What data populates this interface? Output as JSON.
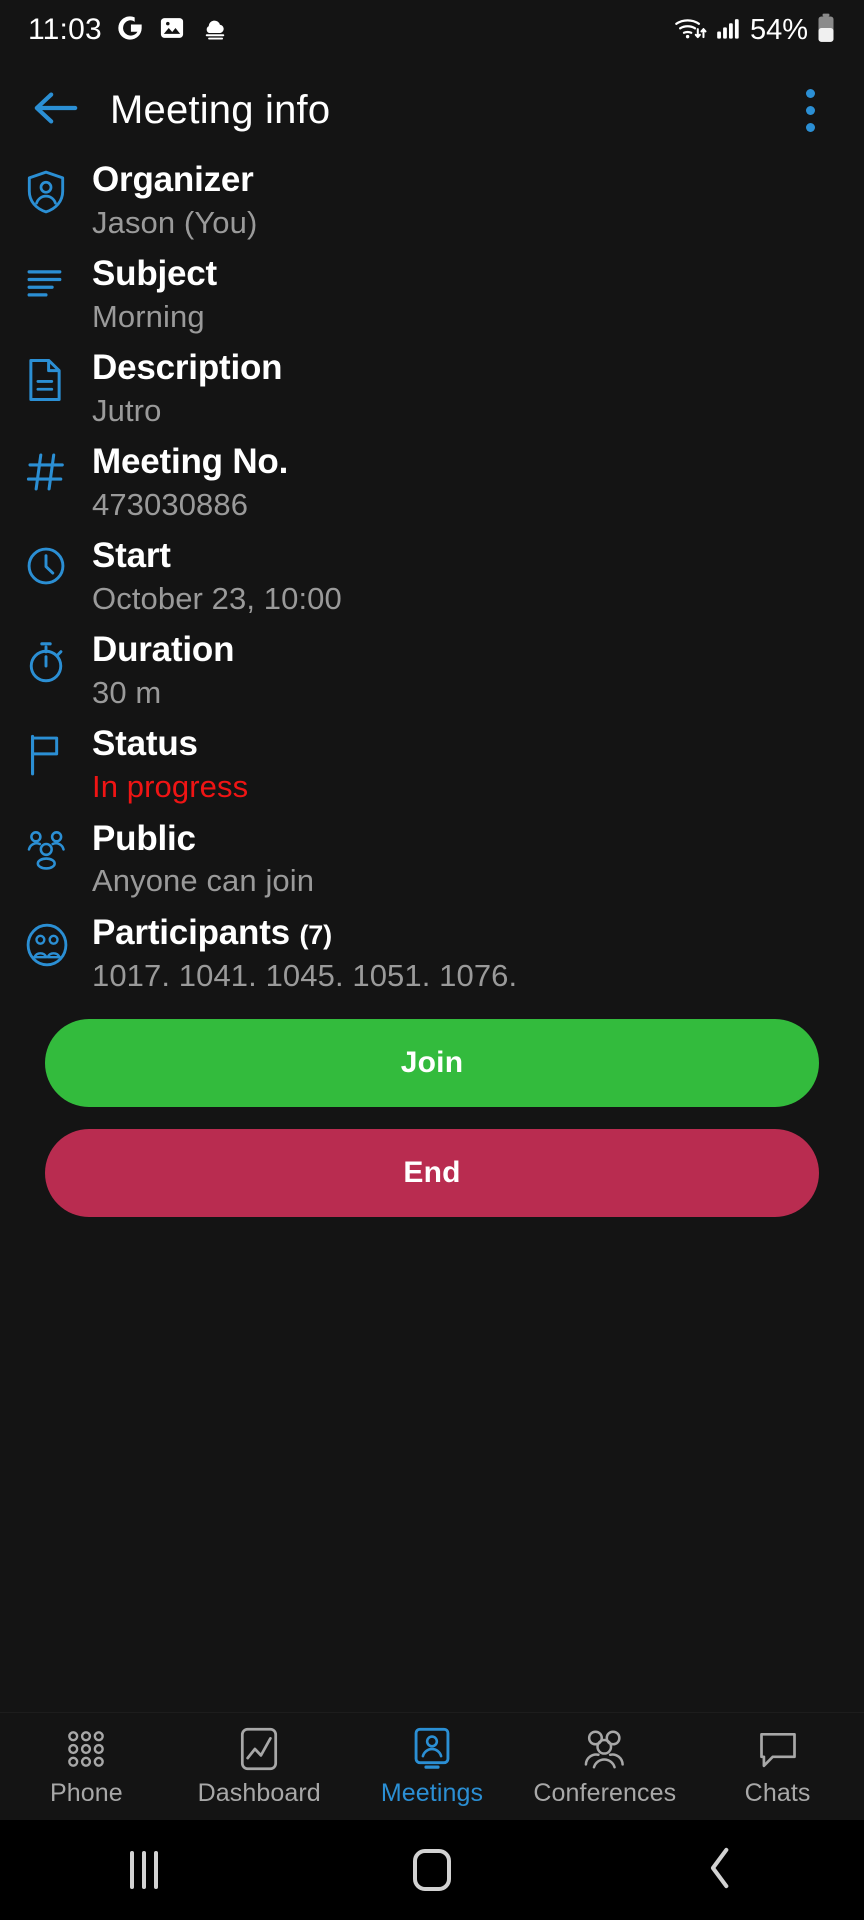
{
  "status_bar": {
    "time": "11:03",
    "left_icons": [
      "google-icon",
      "photo-icon",
      "weather-cloud-icon"
    ],
    "wifi_icon": "wifi-icon",
    "signal_icon": "cellular-signal-icon",
    "battery_percent": "54%",
    "battery_icon": "battery-icon"
  },
  "header": {
    "back_icon": "back-arrow-icon",
    "title": "Meeting info",
    "overflow_icon": "more-vertical-icon"
  },
  "accent_colors": {
    "blue": "#2b8fd4",
    "green": "#33bb3d",
    "crimson": "#b92c50",
    "red_status": "#f01414",
    "value_gray": "#9a9a9a",
    "background": "#141414"
  },
  "info_rows": [
    {
      "icon": "shield-person-icon",
      "label": "Organizer",
      "value": "Jason (You)",
      "count": "",
      "value_color": "gray"
    },
    {
      "icon": "text-lines-icon",
      "label": "Subject",
      "value": "Morning",
      "count": "",
      "value_color": "gray"
    },
    {
      "icon": "document-icon",
      "label": "Description",
      "value": "Jutro",
      "count": "",
      "value_color": "gray"
    },
    {
      "icon": "hash-icon",
      "label": "Meeting No.",
      "value": "473030886",
      "count": "",
      "value_color": "gray"
    },
    {
      "icon": "clock-icon",
      "label": "Start",
      "value": "October 23, 10:00",
      "count": "",
      "value_color": "gray"
    },
    {
      "icon": "stopwatch-icon",
      "label": "Duration",
      "value": "30 m",
      "count": "",
      "value_color": "gray"
    },
    {
      "icon": "flag-icon",
      "label": "Status",
      "value": "In progress",
      "count": "",
      "value_color": "red"
    },
    {
      "icon": "group-people-icon",
      "label": "Public",
      "value": "Anyone can join",
      "count": "",
      "value_color": "gray"
    },
    {
      "icon": "participants-circle-icon",
      "label": "Participants",
      "value": "1017. 1041. 1045. 1051. 1076.",
      "count": "(7)",
      "value_color": "gray"
    }
  ],
  "actions": {
    "join_label": "Join",
    "end_label": "End"
  },
  "tabs": [
    {
      "label": "Phone",
      "icon": "dialpad-icon",
      "active": false
    },
    {
      "label": "Dashboard",
      "icon": "chart-icon",
      "active": false
    },
    {
      "label": "Meetings",
      "icon": "meeting-icon",
      "active": true
    },
    {
      "label": "Conferences",
      "icon": "conference-icon",
      "active": false
    },
    {
      "label": "Chats",
      "icon": "chat-bubble-icon",
      "active": false
    }
  ],
  "system_nav": {
    "recents_icon": "recents-icon",
    "home_icon": "home-icon",
    "back_icon": "system-back-icon"
  }
}
